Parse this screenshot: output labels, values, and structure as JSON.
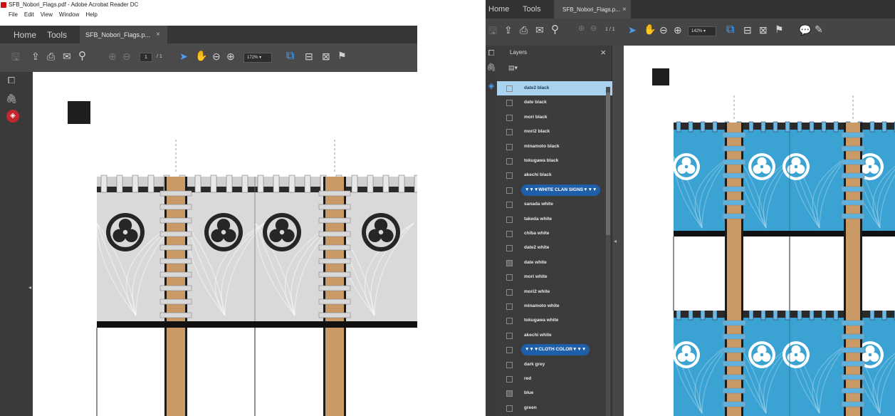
{
  "left_window": {
    "title": "SFB_Nobori_Flags.pdf - Adobe Acrobat Reader DC",
    "menu": [
      "File",
      "Edit",
      "View",
      "Window",
      "Help"
    ],
    "tabs": {
      "home": "Home",
      "tools": "Tools",
      "doc": "SFB_Nobori_Flags.p...",
      "close": "×"
    },
    "page_current": "1",
    "page_total": "/ 1",
    "zoom": "172%"
  },
  "right_window": {
    "tabs": {
      "home": "Home",
      "tools": "Tools",
      "doc": "SFB_Nobori_Flags.p...",
      "close": "×"
    },
    "page_current": "1",
    "page_total": "/ 1",
    "zoom": "142%",
    "layers_panel": {
      "title": "Layers",
      "close": "×",
      "options": "▤▾",
      "items": [
        {
          "label": "date2 black",
          "selected": true
        },
        {
          "label": "date black"
        },
        {
          "label": "mori black"
        },
        {
          "label": "mori2 black"
        },
        {
          "label": "minamoto black"
        },
        {
          "label": "tokugawa black"
        },
        {
          "label": "akechi black"
        },
        {
          "label": "▼▼▼WHITE CLAN SIGNS▼▼▼",
          "header": true
        },
        {
          "label": "sanada white"
        },
        {
          "label": "takeda white"
        },
        {
          "label": "chiba white"
        },
        {
          "label": "date2 white"
        },
        {
          "label": "date white",
          "checked": true
        },
        {
          "label": "mori white"
        },
        {
          "label": "mori2 white"
        },
        {
          "label": "minamoto white"
        },
        {
          "label": "tokugawa white"
        },
        {
          "label": "akechi white"
        },
        {
          "label": "▼▼▼CLOTH COLOR▼▼▼",
          "header": true
        },
        {
          "label": "dark grey"
        },
        {
          "label": "red"
        },
        {
          "label": "blue",
          "checked": true
        },
        {
          "label": "green"
        }
      ]
    }
  },
  "colors": {
    "acrobat_dark": "#363636",
    "toolbar": "#4a4a4a",
    "accent_blue": "#4aa0f5",
    "layer_selected": "#a9d3ef",
    "layer_header_pill": "#1f5ea8",
    "flag_grey": "#d9d9d9",
    "flag_blue": "#3aa3d3",
    "pole_wood": "#c99a66",
    "active_icon_red": "#c4262e"
  },
  "icons": [
    "save-icon",
    "share-icon",
    "print-icon",
    "mail-icon",
    "search-icon",
    "page-up-icon",
    "page-down-icon",
    "pointer-icon",
    "hand-icon",
    "zoom-out-icon",
    "zoom-in-icon",
    "fit-page-icon",
    "scroll-mode-icon",
    "fullscreen-icon",
    "comment-icon",
    "pen-icon",
    "pages-icon",
    "attachment-icon",
    "layers-icon"
  ]
}
